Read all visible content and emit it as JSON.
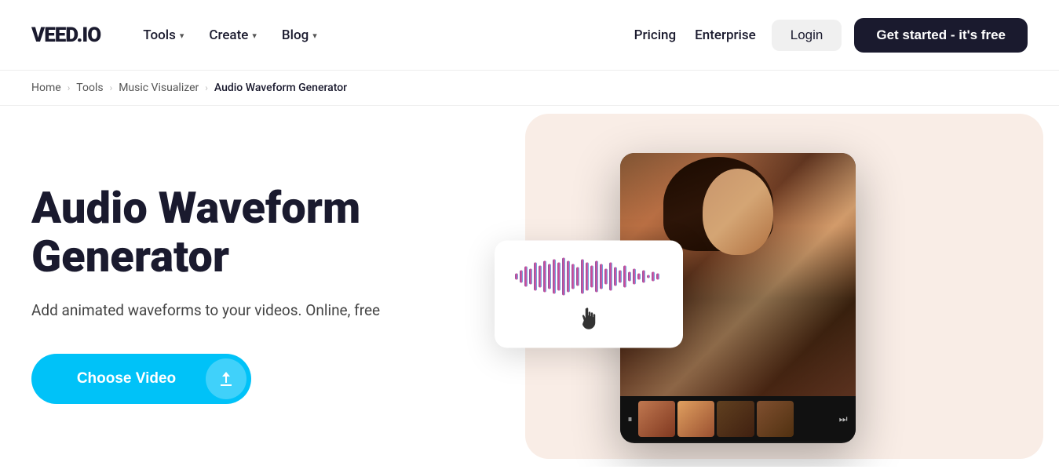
{
  "brand": {
    "logo": "VEED.IO"
  },
  "navbar": {
    "left_items": [
      {
        "label": "Tools",
        "has_dropdown": true
      },
      {
        "label": "Create",
        "has_dropdown": true
      },
      {
        "label": "Blog",
        "has_dropdown": true
      }
    ],
    "right_items": [
      {
        "label": "Pricing"
      },
      {
        "label": "Enterprise"
      }
    ],
    "login_label": "Login",
    "cta_label": "Get started - it's free"
  },
  "breadcrumb": {
    "items": [
      {
        "label": "Home"
      },
      {
        "label": "Tools"
      },
      {
        "label": "Music Visualizer"
      },
      {
        "label": "Audio Waveform Generator",
        "current": true
      }
    ]
  },
  "hero": {
    "title": "Audio Waveform Generator",
    "subtitle": "Add animated waveforms to your videos. Online, free",
    "cta_label": "Choose Video",
    "upload_icon": "⬆"
  },
  "filmstrip": {
    "play_icon": "▶",
    "pause_icon": "⏸"
  }
}
